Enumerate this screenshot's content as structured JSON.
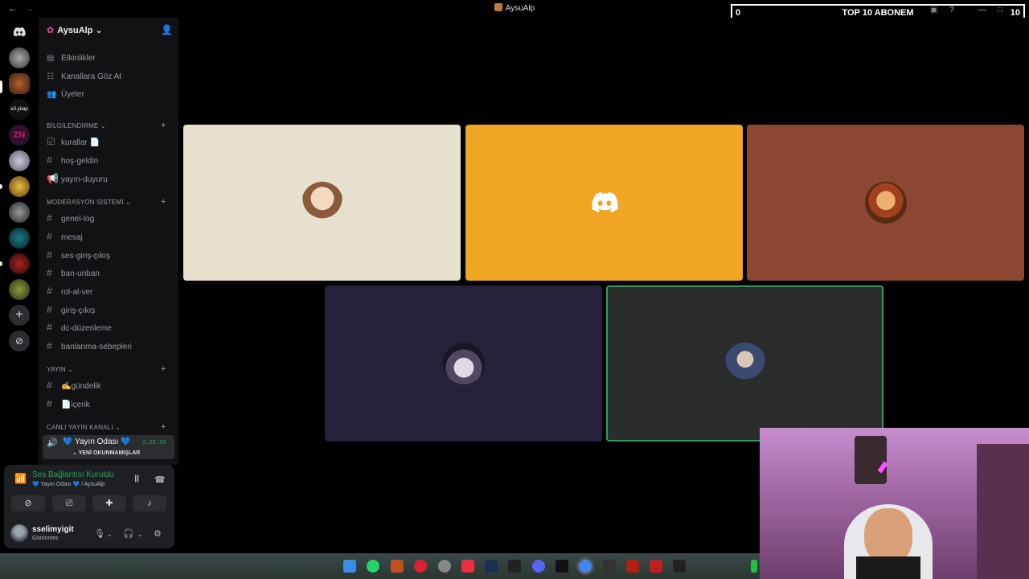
{
  "window": {
    "title": "AysuAlp",
    "back_icon": "arrow-left-icon",
    "forward_icon": "arrow-right-icon"
  },
  "overlay": {
    "left_value": "0",
    "title": "TOP 10 ABONEM",
    "right_value": "10"
  },
  "server": {
    "name": "AysuAlp"
  },
  "nav_items": [
    {
      "label": "Etkinlikler",
      "icon": "calendar-icon"
    },
    {
      "label": "Kanallara Göz At",
      "icon": "browse-icon"
    },
    {
      "label": "Üyeler",
      "icon": "members-icon"
    }
  ],
  "categories": {
    "bilgilendirme": {
      "label": "BİLGİLENDİRME",
      "channels": [
        "kurallar 📄",
        "hoş-geldin",
        "yayın-duyuru"
      ]
    },
    "moderasyon": {
      "label": "MODERASYON SİSTEMİ",
      "channels": [
        "genel-log",
        "mesaj",
        "ses-giriş-çıkış",
        "ban-unban",
        "rol-al-ver",
        "giriş-çıkış",
        "dc-düzenleme",
        "banlanma-sebepleri"
      ]
    },
    "yayin": {
      "label": "YAYIN",
      "channels": [
        "✍️gündelik",
        "📄içerik"
      ]
    },
    "canli": {
      "label": "CANLI YAYIN KANALI",
      "voice_channel": "💙 Yayın Odası 💙",
      "elapsed": "2:25:56",
      "unread_label": "YENİ OKUNMAMIŞLAR"
    }
  },
  "voice_panel": {
    "status": "Ses Bağlantısı Kuruldu",
    "channel": "💙 Yayın Odası 💙 / AysuAlp"
  },
  "user": {
    "name": "sselimyigit",
    "status": "Görünmez"
  },
  "tiles": [
    {
      "name": "participant-1",
      "bg": "#e7e0cf"
    },
    {
      "name": "participant-2",
      "bg": "#f0a622"
    },
    {
      "name": "participant-3",
      "bg": "#8b4731"
    },
    {
      "name": "participant-4",
      "bg": "#26203b"
    },
    {
      "name": "participant-5",
      "bg": "#2a2c2b",
      "speaking": true
    }
  ],
  "colors": {
    "accent_green": "#23a55a",
    "blurple": "#5865f2"
  }
}
